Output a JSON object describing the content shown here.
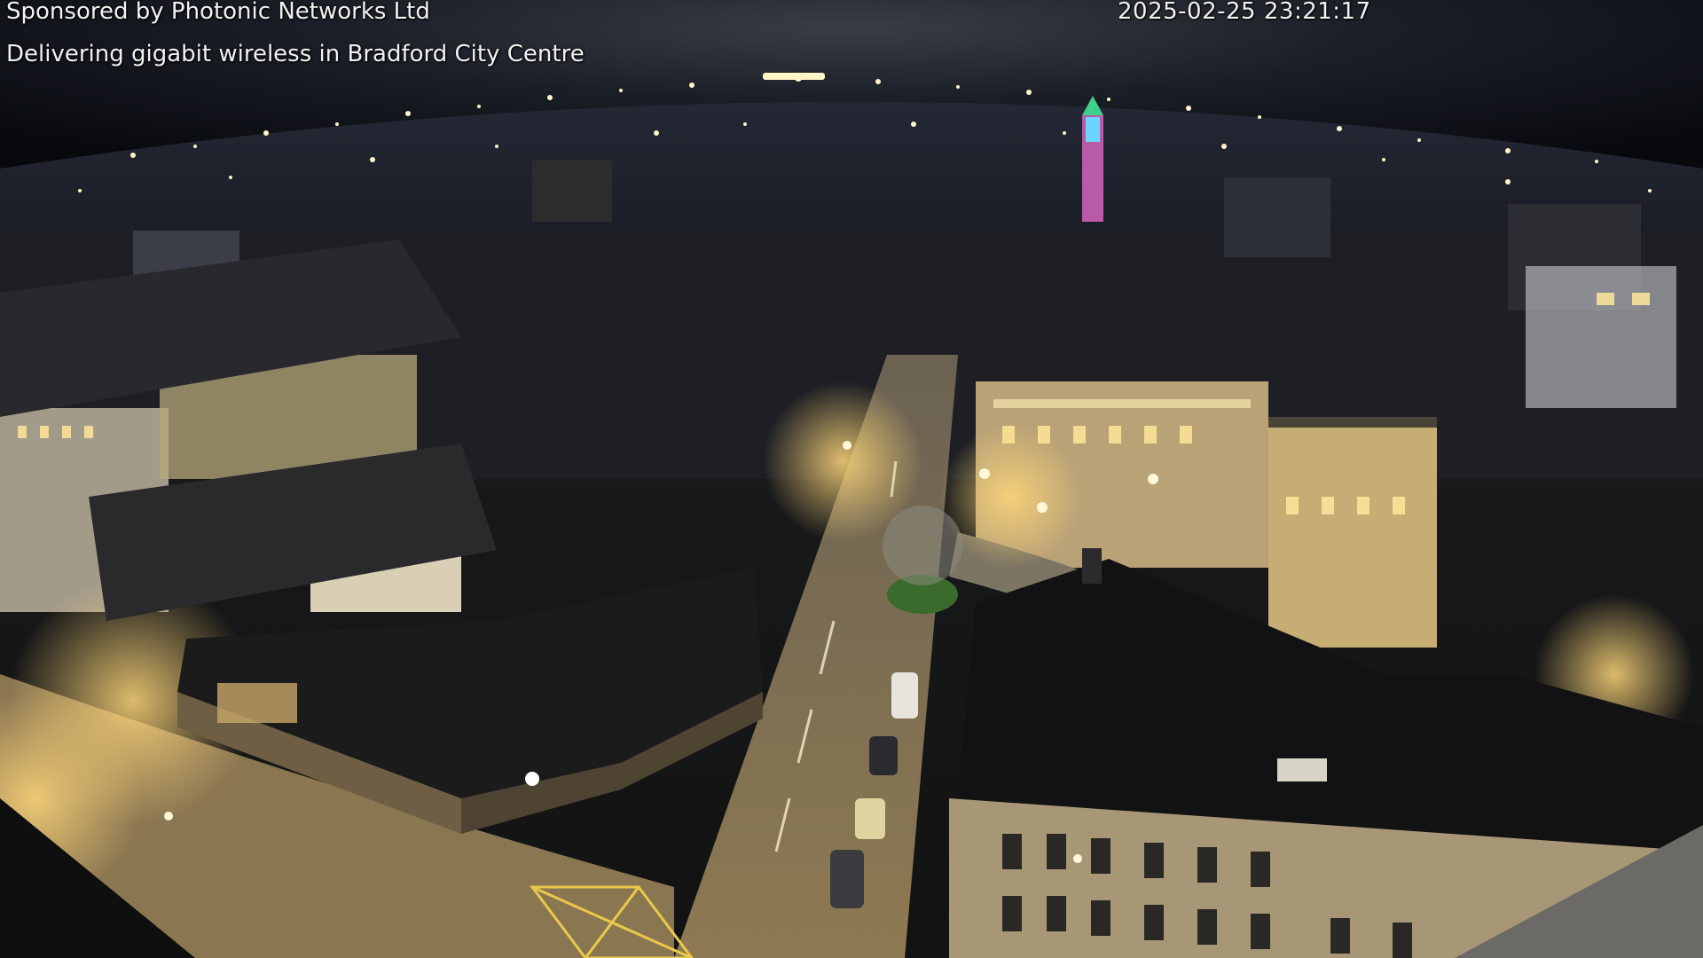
{
  "overlay": {
    "sponsor": "Sponsored by Photonic Networks Ltd",
    "tagline": "Delivering gigabit wireless in Bradford City Centre",
    "timestamp": "2025-02-25 23:21:17"
  },
  "scene": {
    "description_kind": "night-webcam-cityscape",
    "sky_color": "#10141c",
    "light_color": "#fff6c8",
    "street_light_color": "#f3c15a",
    "tower_light_color": "#6ad6ff"
  }
}
